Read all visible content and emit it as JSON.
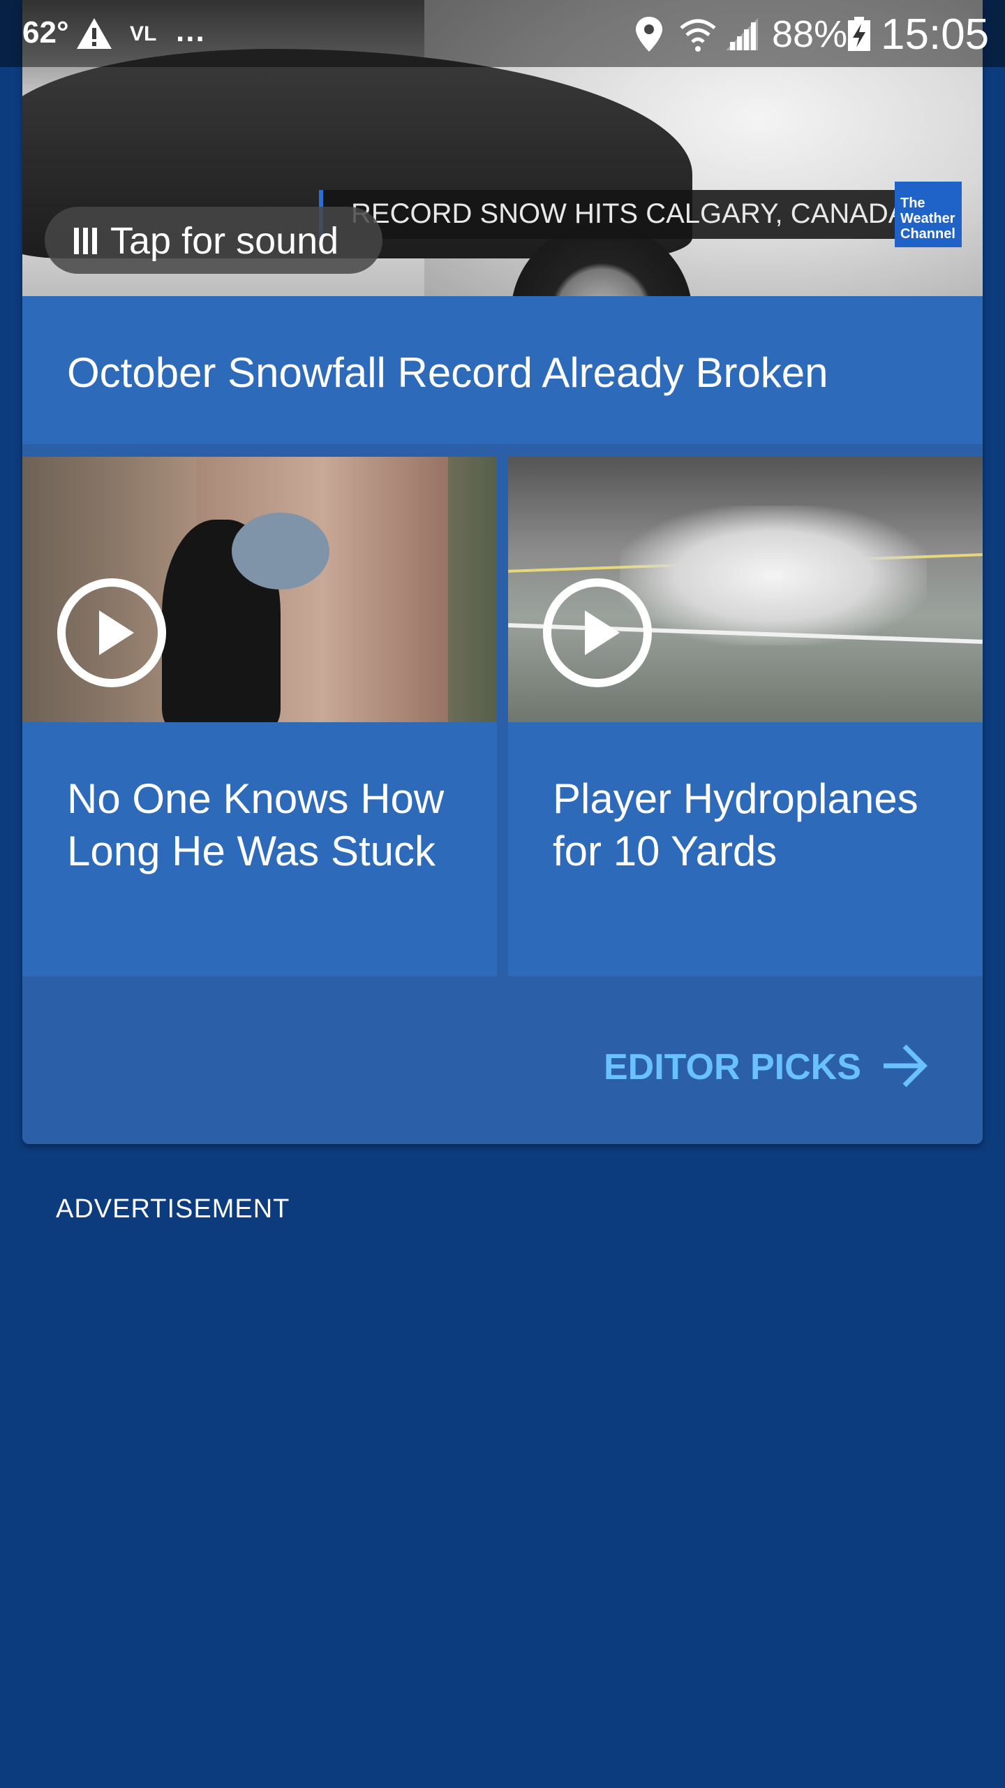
{
  "status_bar": {
    "temperature": "62°",
    "carrier": "VL",
    "more": "...",
    "battery_percent": "88%",
    "time": "15:05",
    "icons": [
      "warning-icon",
      "location-icon",
      "wifi-icon",
      "signal-icon",
      "battery-charging-icon"
    ]
  },
  "hero_video": {
    "ticker_text": "RECORD SNOW HITS CALGARY, CANADA",
    "logo_text": "The Weather Channel",
    "sound_button_label": "Tap for sound",
    "headline": "October Snowfall Record Already Broken"
  },
  "videos": [
    {
      "title": "No One Knows How Long He Was Stuck",
      "icon": "play-icon"
    },
    {
      "title": "Player Hydroplanes for 10 Yards",
      "icon": "play-icon"
    }
  ],
  "editor_picks": {
    "label": "EDITOR PICKS",
    "icon": "arrow-right-icon",
    "color": "#69c1ff"
  },
  "advertisement_label": "ADVERTISEMENT",
  "colors": {
    "background": "#0d3c7e",
    "card": "#2b5fa8",
    "headline_panel": "#2d6ab9"
  }
}
